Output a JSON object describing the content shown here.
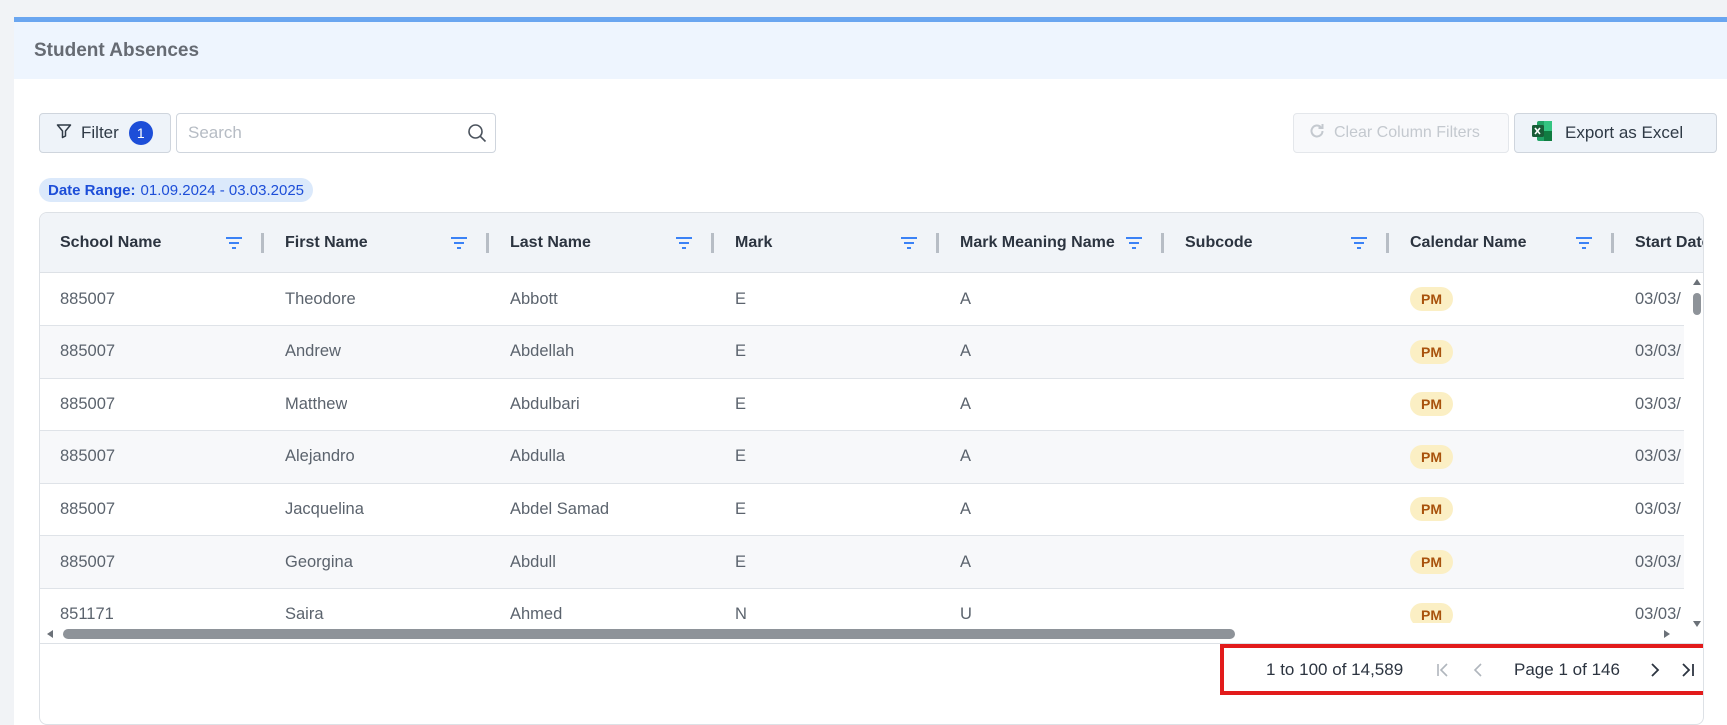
{
  "card": {
    "title": "Student Absences"
  },
  "toolbar": {
    "filter_label": "Filter",
    "filter_count": "1",
    "search_placeholder": "Search",
    "search_value": "",
    "clear_label": "Clear Column Filters",
    "export_label": "Export as Excel"
  },
  "date_range": {
    "key": "Date Range:",
    "value": "01.09.2024 - 03.03.2025"
  },
  "grid": {
    "columns": [
      "School Name",
      "First Name",
      "Last Name",
      "Mark",
      "Mark Meaning Name",
      "Subcode",
      "Calendar Name",
      "Start Date"
    ],
    "rows": [
      {
        "school": "885007",
        "first": "Theodore",
        "last": "Abbott",
        "mark": "E",
        "meaning": "A",
        "subcode": "",
        "calendar": "PM",
        "start": "03/03/"
      },
      {
        "school": "885007",
        "first": "Andrew",
        "last": "Abdellah",
        "mark": "E",
        "meaning": "A",
        "subcode": "",
        "calendar": "PM",
        "start": "03/03/"
      },
      {
        "school": "885007",
        "first": "Matthew",
        "last": "Abdulbari",
        "mark": "E",
        "meaning": "A",
        "subcode": "",
        "calendar": "PM",
        "start": "03/03/"
      },
      {
        "school": "885007",
        "first": "Alejandro",
        "last": "Abdulla",
        "mark": "E",
        "meaning": "A",
        "subcode": "",
        "calendar": "PM",
        "start": "03/03/"
      },
      {
        "school": "885007",
        "first": "Jacquelina",
        "last": "Abdel Samad",
        "mark": "E",
        "meaning": "A",
        "subcode": "",
        "calendar": "PM",
        "start": "03/03/"
      },
      {
        "school": "885007",
        "first": "Georgina",
        "last": "Abdull",
        "mark": "E",
        "meaning": "A",
        "subcode": "",
        "calendar": "PM",
        "start": "03/03/"
      },
      {
        "school": "851171",
        "first": "Saira",
        "last": "Ahmed",
        "mark": "N",
        "meaning": "U",
        "subcode": "",
        "calendar": "PM",
        "start": "03/03/"
      }
    ]
  },
  "pager": {
    "from": "1",
    "to_word": "to",
    "to": "100",
    "of_word": "of",
    "total": "14,589",
    "page_word": "Page",
    "page": "1",
    "page_of_word": "of",
    "page_count": "146"
  },
  "colors": {
    "accent": "#1d4ed8",
    "header_bar": "#6aa6f0",
    "badge_bg": "#fbefc4",
    "badge_text": "#a8520c",
    "highlight": "#e21b1b"
  },
  "icons": [
    "filter-icon",
    "search-icon",
    "refresh-icon",
    "excel-icon",
    "column-filter-icon",
    "first-page-icon",
    "prev-page-icon",
    "next-page-icon",
    "last-page-icon"
  ]
}
